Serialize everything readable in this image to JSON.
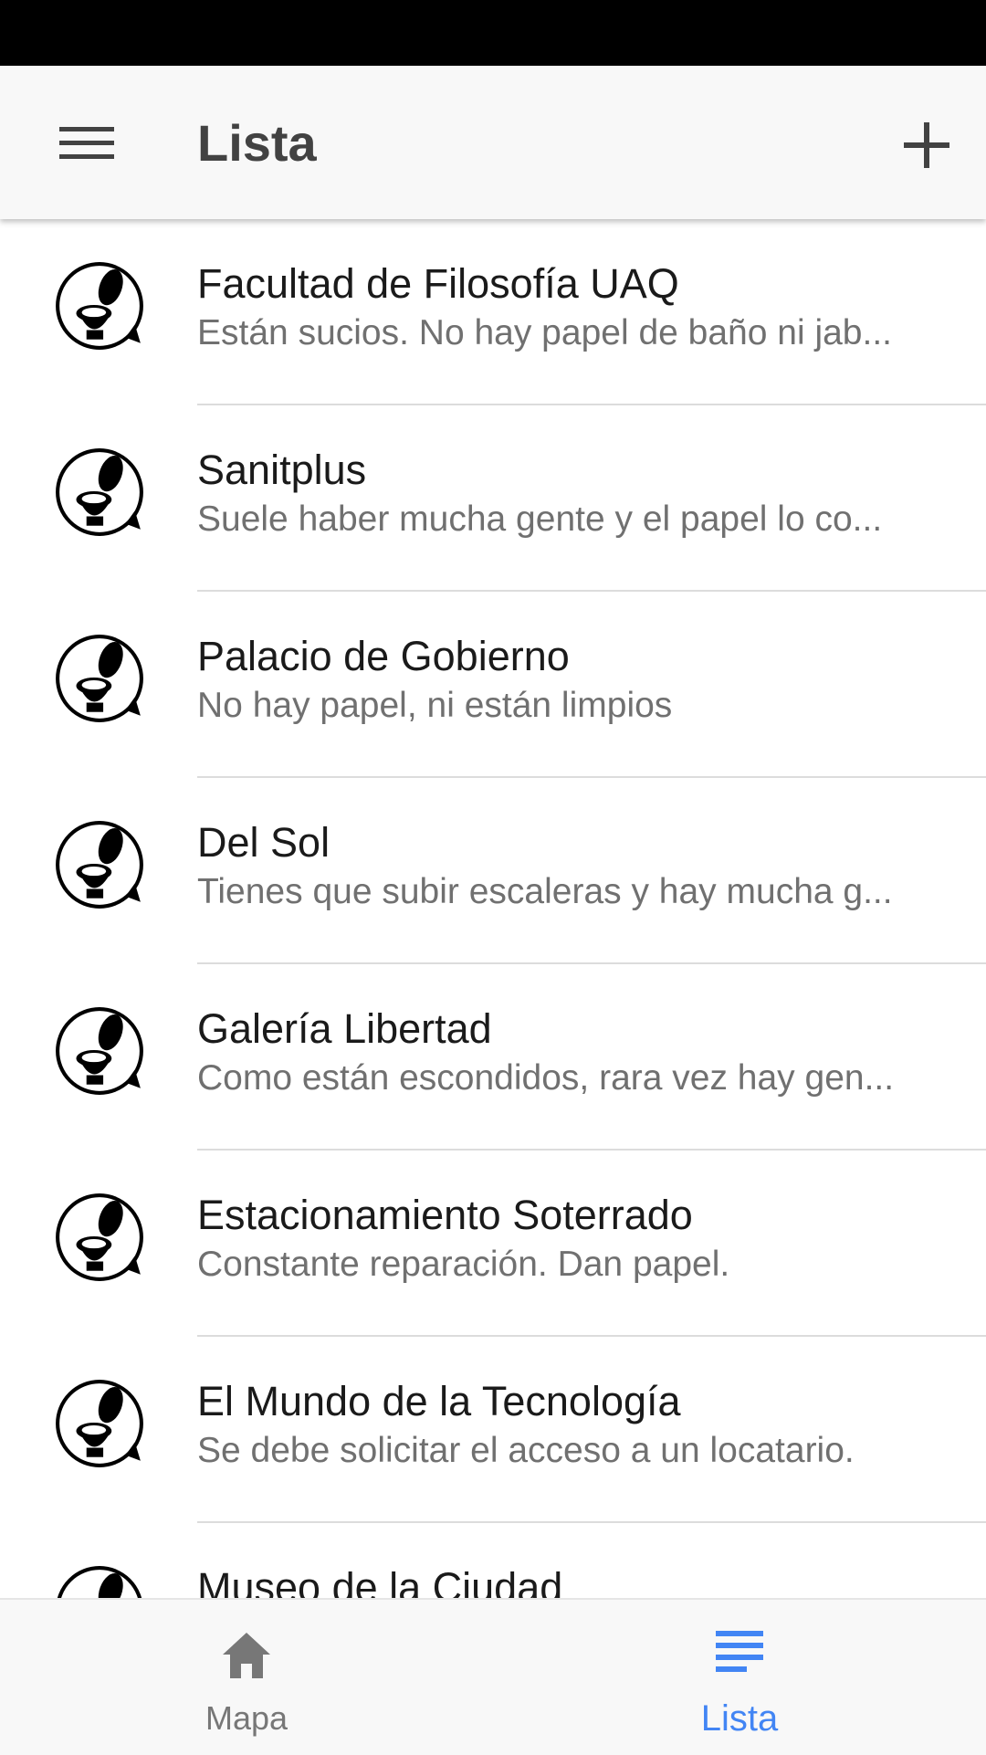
{
  "colors": {
    "accent": "#4285f4",
    "header_text": "#424242",
    "title_text": "#1a1a1a",
    "subtitle_text": "#707070",
    "inactive_tab": "#777777"
  },
  "app_bar": {
    "title": "Lista",
    "menu_icon": "menu-icon",
    "add_icon": "plus-icon"
  },
  "list": {
    "items": [
      {
        "title": "Facultad de Filosofía UAQ",
        "subtitle": "Están sucios. No hay papel de baño ni jab...",
        "icon": "toilet-icon"
      },
      {
        "title": "Sanitplus",
        "subtitle": "Suele haber mucha gente y el papel lo co...",
        "icon": "toilet-icon"
      },
      {
        "title": "Palacio de Gobierno",
        "subtitle": "No hay papel, ni están limpios",
        "icon": "toilet-icon"
      },
      {
        "title": "Del Sol",
        "subtitle": "Tienes que subir escaleras y hay mucha g...",
        "icon": "toilet-icon"
      },
      {
        "title": "Galería Libertad",
        "subtitle": "Como están escondidos, rara vez hay gen...",
        "icon": "toilet-icon"
      },
      {
        "title": "Estacionamiento Soterrado",
        "subtitle": "Constante reparación. Dan papel.",
        "icon": "toilet-icon"
      },
      {
        "title": "El Mundo de la Tecnología",
        "subtitle": "Se debe solicitar el acceso a un locatario.",
        "icon": "toilet-icon"
      },
      {
        "title": "Museo de la Ciudad",
        "subtitle": "",
        "icon": "toilet-icon"
      }
    ]
  },
  "bottom_nav": {
    "tabs": [
      {
        "label": "Mapa",
        "icon": "home-icon",
        "active": false
      },
      {
        "label": "Lista",
        "icon": "list-icon",
        "active": true
      }
    ]
  }
}
